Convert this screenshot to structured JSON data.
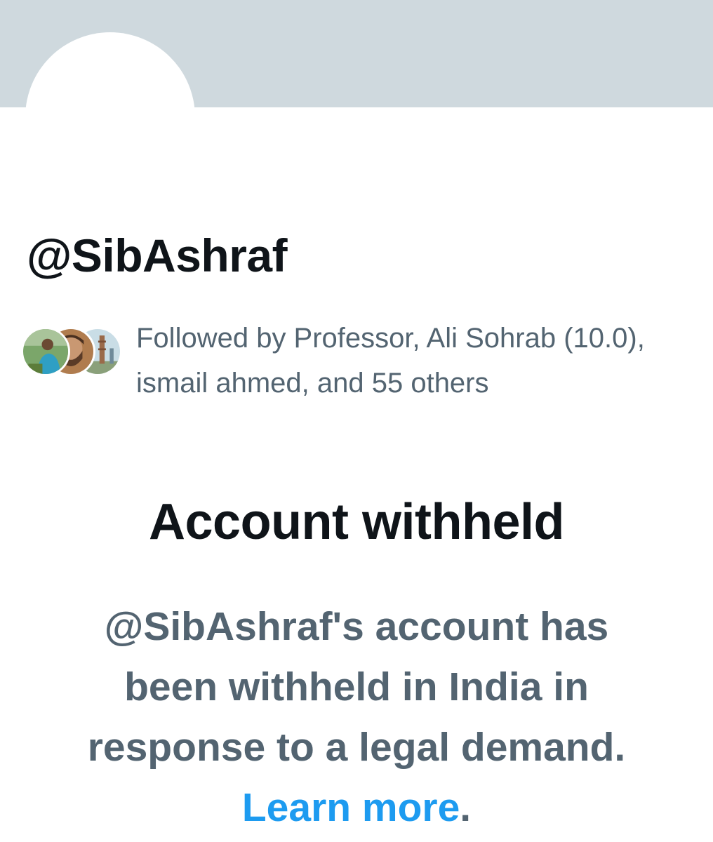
{
  "profile": {
    "handle": "@SibAshraf"
  },
  "followers": {
    "text": "Followed by Professor, Ali Sohrab (10.0), ismail ahmed, and 55 others"
  },
  "withheld": {
    "title": "Account withheld",
    "body": "@SibAshraf's account has been withheld in India in response to a legal demand.",
    "link_label": "Learn more",
    "end_punct": "."
  },
  "colors": {
    "banner": "#cfd9de",
    "primary_text": "#0f1419",
    "secondary_text": "#536471",
    "link": "#1d9bf0"
  }
}
